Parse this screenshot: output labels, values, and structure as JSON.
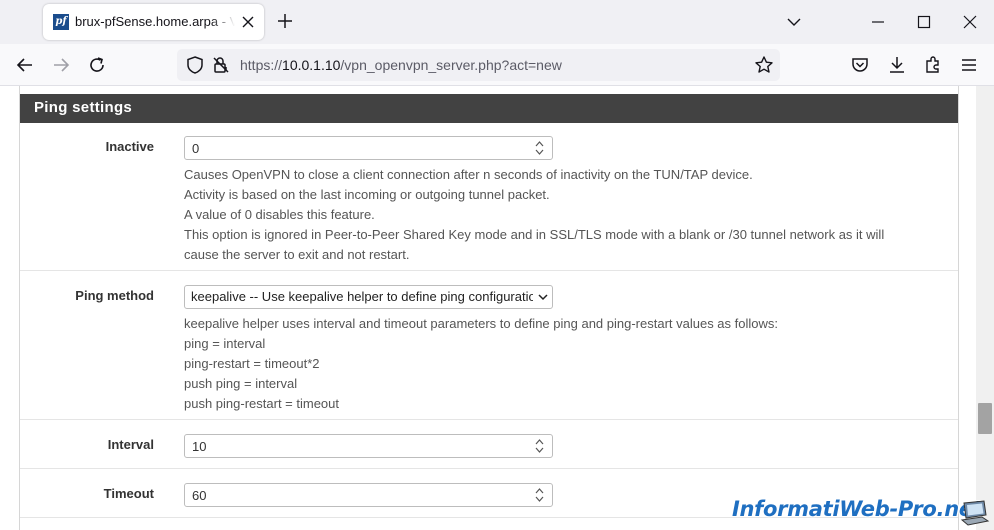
{
  "browser": {
    "tab": {
      "favicon_text": "pf",
      "title": "brux-pfSense.home.arpa - VPN: OpenVPN: Servers: Edit"
    },
    "url": {
      "prefix": "https://",
      "host": "10.0.1.10",
      "path": "/vpn_openvpn_server.php?act=new"
    }
  },
  "section": {
    "title": "Ping settings"
  },
  "rows": {
    "inactive": {
      "label": "Inactive",
      "value": "0",
      "help": [
        "Causes OpenVPN to close a client connection after n seconds of inactivity on the TUN/TAP device.",
        "Activity is based on the last incoming or outgoing tunnel packet.",
        "A value of 0 disables this feature.",
        "This option is ignored in Peer-to-Peer Shared Key mode and in SSL/TLS mode with a blank or /30 tunnel network as it will",
        "cause the server to exit and not restart."
      ]
    },
    "ping_method": {
      "label": "Ping method",
      "selected": "keepalive -- Use keepalive helper to define ping configuration",
      "help": [
        "keepalive helper uses interval and timeout parameters to define ping and ping-restart values as follows:",
        "ping = interval",
        "ping-restart = timeout*2",
        "push ping = interval",
        "push ping-restart = timeout"
      ]
    },
    "interval": {
      "label": "Interval",
      "value": "10"
    },
    "timeout": {
      "label": "Timeout",
      "value": "60"
    }
  },
  "watermark": {
    "text": "InformatiWeb-Pro.net"
  },
  "colors": {
    "panel_heading": "#424242",
    "watermark": "#1f6fc1"
  }
}
